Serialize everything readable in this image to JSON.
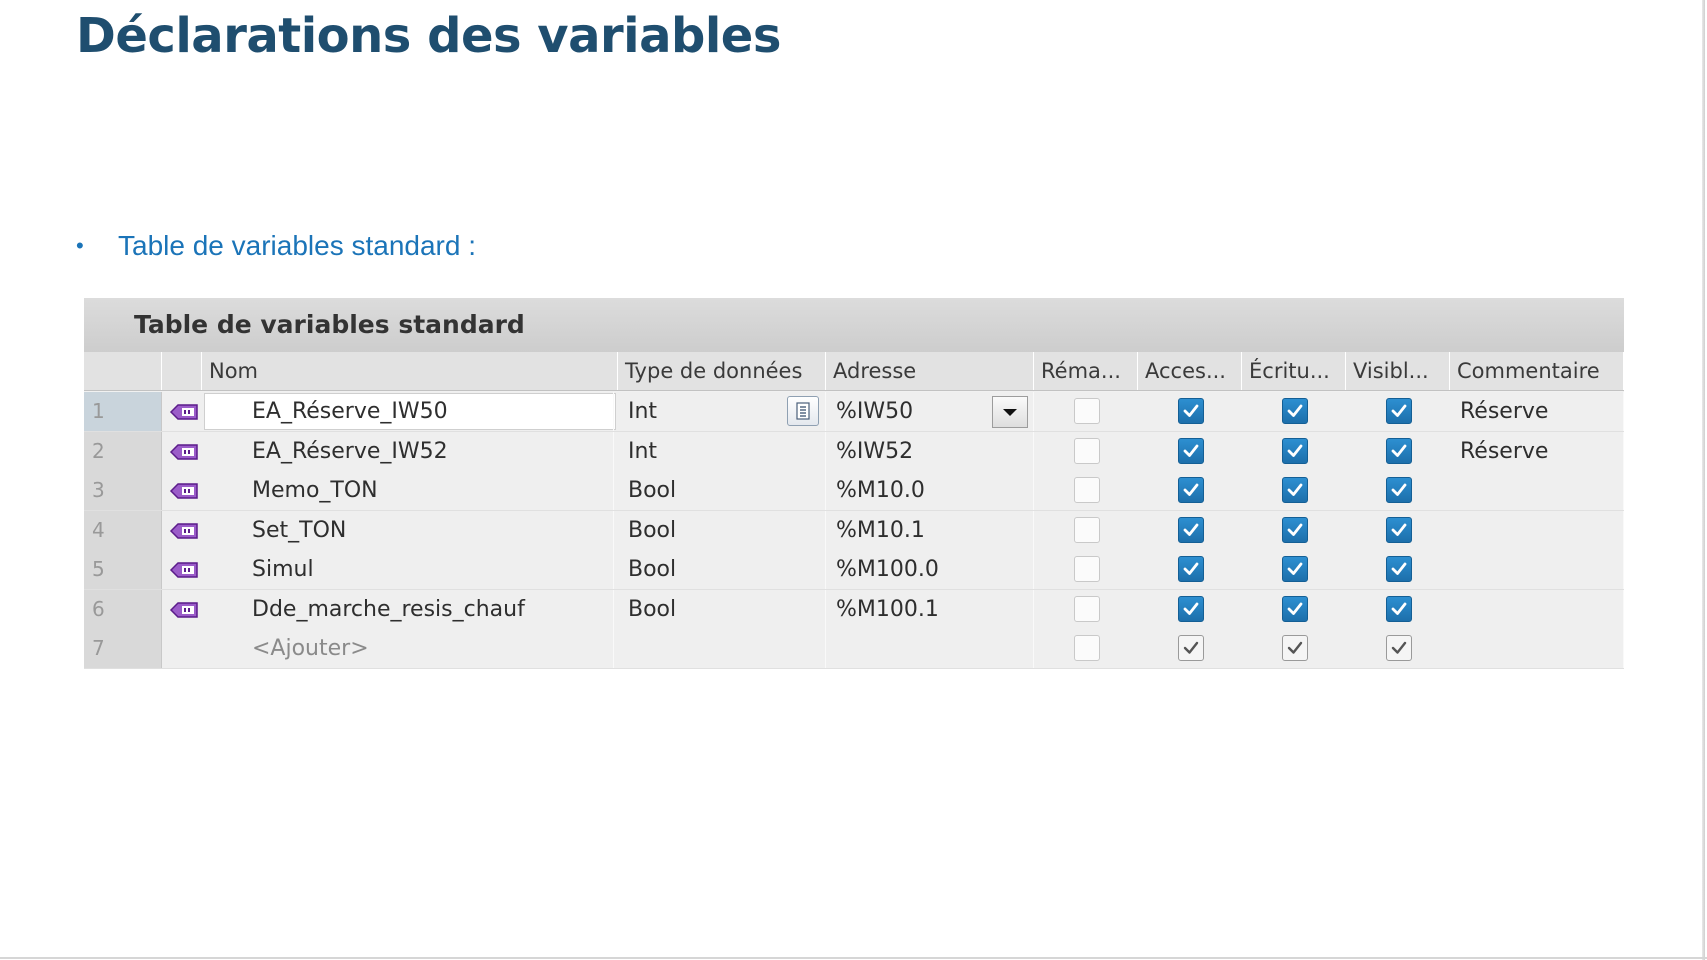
{
  "slide": {
    "title": "Déclarations des variables",
    "bullet_text": "Table de variables standard :",
    "bullet_symbol": "•",
    "title_color": "#1f4e6f",
    "bullet_color": "#1b74b8"
  },
  "table": {
    "title": "Table de variables standard",
    "columns": [
      "Nom",
      "Type de données",
      "Adresse",
      "Réma...",
      "Acces...",
      "Écritu...",
      "Visibl...",
      "Commentaire"
    ],
    "rows": [
      {
        "num": "1",
        "name": "EA_Réserve_IW50",
        "type": "Int",
        "address": "%IW50",
        "retain": false,
        "access": true,
        "write": true,
        "visible": true,
        "comment": "Réserve"
      },
      {
        "num": "2",
        "name": "EA_Réserve_IW52",
        "type": "Int",
        "address": "%IW52",
        "retain": false,
        "access": true,
        "write": true,
        "visible": true,
        "comment": "Réserve"
      },
      {
        "num": "3",
        "name": "Memo_TON",
        "type": "Bool",
        "address": "%M10.0",
        "retain": false,
        "access": true,
        "write": true,
        "visible": true,
        "comment": ""
      },
      {
        "num": "4",
        "name": "Set_TON",
        "type": "Bool",
        "address": "%M10.1",
        "retain": false,
        "access": true,
        "write": true,
        "visible": true,
        "comment": ""
      },
      {
        "num": "5",
        "name": "Simul",
        "type": "Bool",
        "address": "%M100.0",
        "retain": false,
        "access": true,
        "write": true,
        "visible": true,
        "comment": ""
      },
      {
        "num": "6",
        "name": "Dde_marche_resis_chauf",
        "type": "Bool",
        "address": "%M100.1",
        "retain": false,
        "access": true,
        "write": true,
        "visible": true,
        "comment": ""
      }
    ],
    "add_row": {
      "num": "7",
      "placeholder": "<Ajouter>"
    },
    "icons": {
      "tag": "plc-tag-icon",
      "type_picker": "list-picker-icon",
      "address_dropdown": "dropdown-arrow-icon",
      "checkbox": "check-icon"
    },
    "colors": {
      "checkbox_on": "#1d6fab",
      "tag_icon": "#7a2fb0"
    }
  }
}
